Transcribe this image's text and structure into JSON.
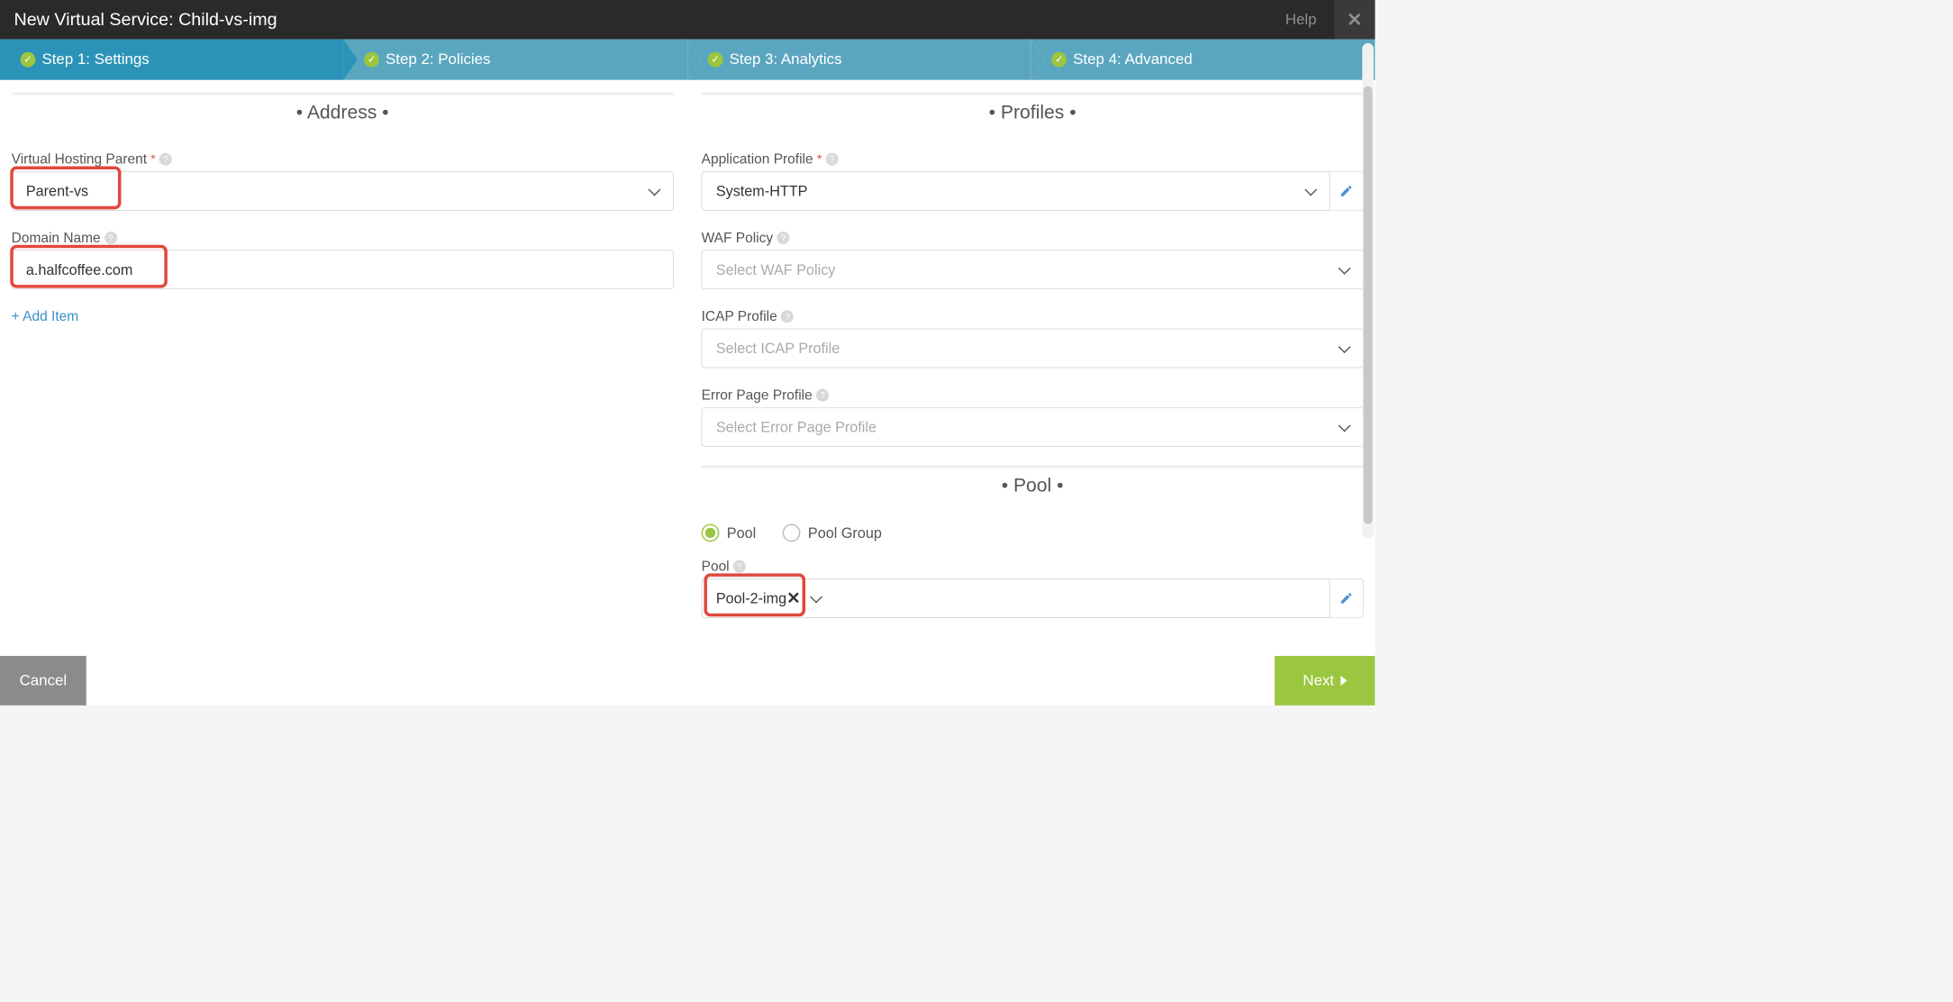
{
  "title": "New Virtual Service: Child-vs-img",
  "help_label": "Help",
  "steps": [
    {
      "label": "Step 1: Settings"
    },
    {
      "label": "Step 2: Policies"
    },
    {
      "label": "Step 3: Analytics"
    },
    {
      "label": "Step 4: Advanced"
    }
  ],
  "sections": {
    "address": "•  Address  •",
    "profiles": "•  Profiles  •",
    "pool": "•  Pool  •"
  },
  "fields": {
    "vhp_label": "Virtual Hosting Parent",
    "vhp_value": "Parent-vs",
    "domain_label": "Domain Name",
    "domain_value": "a.halfcoffee.com",
    "add_item": "+ Add Item",
    "app_profile_label": "Application Profile",
    "app_profile_value": "System-HTTP",
    "waf_label": "WAF Policy",
    "waf_placeholder": "Select WAF Policy",
    "icap_label": "ICAP Profile",
    "icap_placeholder": "Select ICAP Profile",
    "err_label": "Error Page Profile",
    "err_placeholder": "Select Error Page Profile",
    "radio_pool": "Pool",
    "radio_pool_group": "Pool Group",
    "pool_label": "Pool",
    "pool_value": "Pool-2-img"
  },
  "buttons": {
    "cancel": "Cancel",
    "next": "Next"
  }
}
